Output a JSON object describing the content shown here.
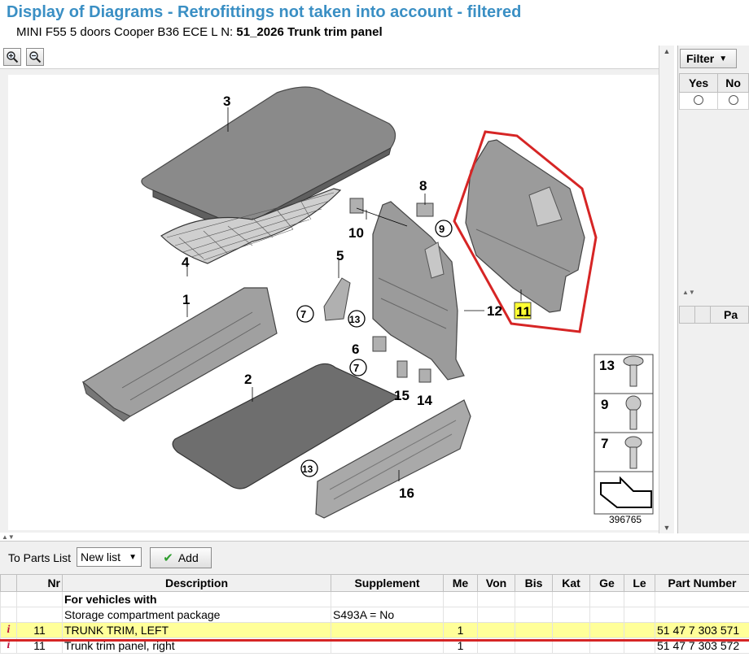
{
  "header": {
    "title": "Display of Diagrams - Retrofittings not taken into account - filtered",
    "subtitle_prefix": "MINI F55 5 doors Cooper B36 ECE  L N: ",
    "subtitle_bold": "51_2026 Trunk trim panel"
  },
  "toolbar": {
    "zoom_in_icon": "zoom-in-magnifier",
    "zoom_out_icon": "zoom-out-magnifier"
  },
  "diagram": {
    "image_number": "396765",
    "highlighted_part": "11",
    "callouts": {
      "c1": "1",
      "c2": "2",
      "c3": "3",
      "c4": "4",
      "c5": "5",
      "c6": "6",
      "c7a": "7",
      "c7b": "7",
      "c8": "8",
      "c9": "9",
      "c10": "10",
      "c12": "12",
      "c13a": "13",
      "c13b": "13",
      "c14": "14",
      "c15": "15",
      "c16": "16"
    },
    "legend": {
      "l13": "13",
      "l9": "9",
      "l7": "7"
    },
    "colors": {
      "highlight_outline": "#d62525",
      "highlight_label_bg": "#ffff33"
    }
  },
  "filter_panel": {
    "button_label": "Filter",
    "col_yes": "Yes",
    "col_no": "No",
    "lower_header": "Pa"
  },
  "actions": {
    "to_parts_list_label": "To Parts List",
    "list_select_value": "New list",
    "add_label": "Add"
  },
  "table": {
    "headers": [
      "",
      "Nr",
      "Description",
      "Supplement",
      "Me",
      "Von",
      "Bis",
      "Kat",
      "Ge",
      "Le",
      "Part Number"
    ],
    "rows": [
      {
        "info": "",
        "nr": "",
        "desc": "For vehicles with",
        "supp": "",
        "me": "",
        "part": "",
        "bold": true
      },
      {
        "info": "",
        "nr": "",
        "desc": "Storage compartment package",
        "supp": "S493A = No",
        "me": "",
        "part": ""
      },
      {
        "info": "i",
        "nr": "11",
        "desc": "TRUNK TRIM, LEFT",
        "supp": "",
        "me": "1",
        "part": "51 47 7 303 571",
        "selected": true
      },
      {
        "info": "i",
        "nr": "11",
        "desc": "Trunk trim panel, right",
        "supp": "",
        "me": "1",
        "part": "51 47 7 303 572"
      }
    ]
  }
}
